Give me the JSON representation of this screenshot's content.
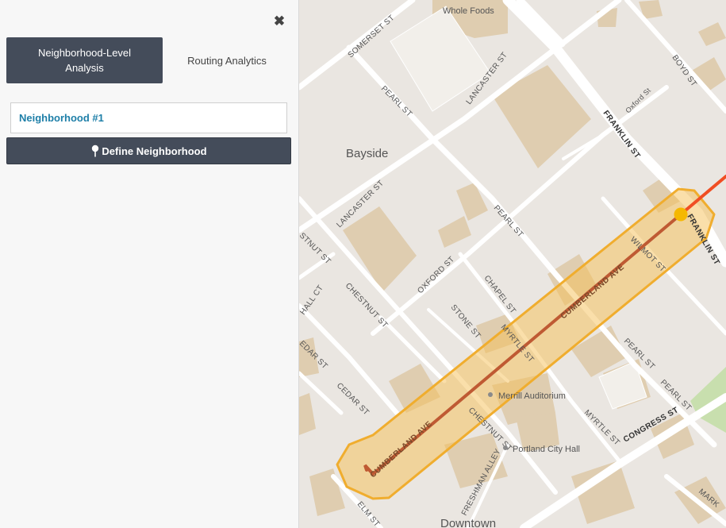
{
  "panel": {
    "close_icon": "close-icon",
    "tabs": [
      {
        "label": "Neighborhood-Level Analysis",
        "active": true
      },
      {
        "label": "Routing Analytics",
        "active": false
      }
    ],
    "neighborhood_item": "Neighborhood #1",
    "define_button": "Define Neighborhood",
    "define_icon": "map-pin-icon"
  },
  "map": {
    "places": {
      "whole_foods": "Whole Foods",
      "bayside": "Bayside",
      "merrill": "Merrill Auditorium",
      "city_hall": "Portland City Hall",
      "downtown": "Downtown"
    },
    "streets": {
      "somerset": "SOMERSET ST",
      "lancaster_top": "LANCASTER ST",
      "pearl_top": "PEARL ST",
      "boyd": "BOYD ST",
      "oxford_top": "Oxford St",
      "franklin_top": "FRANKLIN ST",
      "lancaster_left": "LANCASTER ST",
      "pearl_mid": "PEARL ST",
      "franklin_right": "FRANKLIN ST",
      "wilmot": "WILMOT ST",
      "chestnut_left": "STNUT ST",
      "oxford_mid": "OXFORD ST",
      "hall": "HALL CT",
      "chestnut_mid": "CHESTNUT ST",
      "chapel": "CHAPEL ST",
      "cumberland_upper": "CUMBERLAND AVE",
      "stone": "STONE ST",
      "myrtle_mid": "MYRTLE ST",
      "pearl_lower": "PEARL ST",
      "pearl_lower2": "PEARL ST",
      "cedar_left": "EDAR ST",
      "cedar": "CEDAR ST",
      "congress": "CONGRESS ST",
      "myrtle_low": "MYRTLE ST",
      "cumberland_lower": "CUMBERLAND AVE",
      "chestnut_low": "CHESTNUT ST",
      "freshman": "FRESHMAN ALLEY",
      "elm": "ELM ST",
      "market": "MARK"
    },
    "colors": {
      "buffer_fill": "#f6bf55",
      "buffer_stroke": "#f0ad2e",
      "route": "#bf5a33",
      "route_ext": "#f04e23",
      "marker": "#f5b800"
    }
  }
}
